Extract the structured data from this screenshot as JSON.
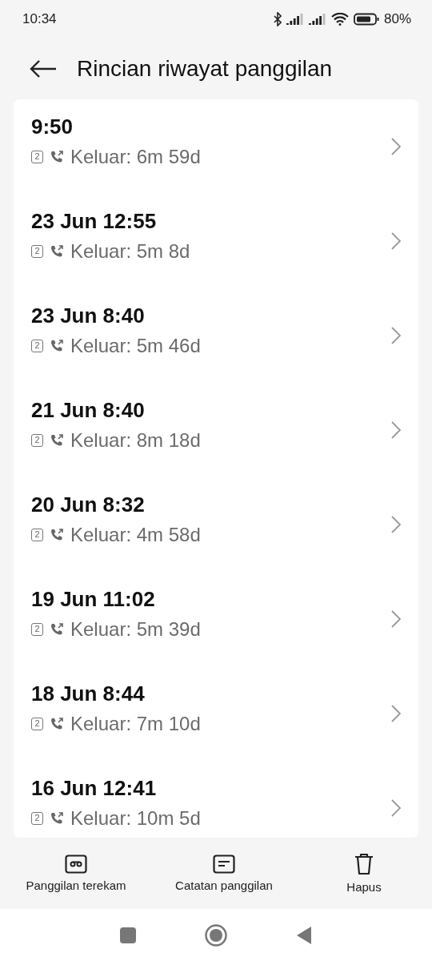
{
  "status_bar": {
    "time": "10:34",
    "battery": "80%"
  },
  "header": {
    "title": "Rincian riwayat panggilan"
  },
  "calls": [
    {
      "time": "9:50",
      "sim": "2",
      "detail": "Keluar: 6m 59d"
    },
    {
      "time": "23 Jun 12:55",
      "sim": "2",
      "detail": "Keluar: 5m 8d"
    },
    {
      "time": "23 Jun 8:40",
      "sim": "2",
      "detail": "Keluar: 5m 46d"
    },
    {
      "time": "21 Jun 8:40",
      "sim": "2",
      "detail": "Keluar: 8m 18d"
    },
    {
      "time": "20 Jun 8:32",
      "sim": "2",
      "detail": "Keluar: 4m 58d"
    },
    {
      "time": "19 Jun 11:02",
      "sim": "2",
      "detail": "Keluar: 5m 39d"
    },
    {
      "time": "18 Jun 8:44",
      "sim": "2",
      "detail": "Keluar: 7m 10d"
    },
    {
      "time": "16 Jun 12:41",
      "sim": "2",
      "detail": "Keluar: 10m 5d"
    }
  ],
  "actions": [
    {
      "kind": "recording",
      "label": "Panggilan terekam"
    },
    {
      "kind": "notes",
      "label": "Catatan panggilan"
    },
    {
      "kind": "delete",
      "label": "Hapus"
    }
  ]
}
